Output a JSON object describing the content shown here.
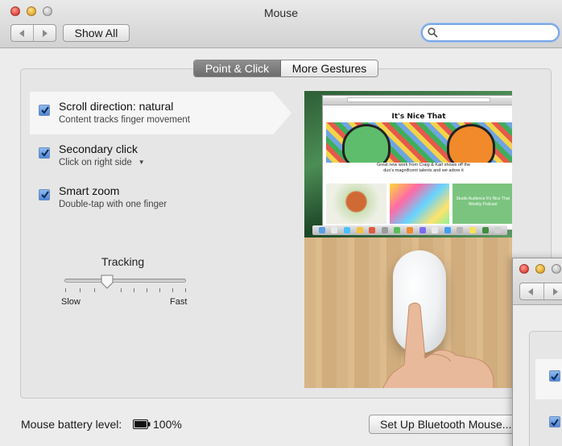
{
  "window": {
    "title": "Mouse",
    "show_all_label": "Show All",
    "search_placeholder": ""
  },
  "tabs": [
    {
      "label": "Point & Click",
      "selected": true
    },
    {
      "label": "More Gestures",
      "selected": false
    }
  ],
  "options": [
    {
      "title": "Scroll direction: natural",
      "subtitle": "Content tracks finger movement",
      "checked": true,
      "highlighted": true
    },
    {
      "title": "Secondary click",
      "subtitle": "Click on right side",
      "checked": true,
      "has_dropdown": true
    },
    {
      "title": "Smart zoom",
      "subtitle": "Double-tap with one finger",
      "checked": true
    }
  ],
  "tracking": {
    "label": "Tracking",
    "min_label": "Slow",
    "max_label": "Fast",
    "value_fraction": 0.35
  },
  "preview": {
    "site_title": "It's Nice That",
    "caption": "Great new work from Craig & Karl shows off the duo's magnificent talents and we adore it",
    "tile_text": "Studio Audience It's Nice That Weekly Podcast"
  },
  "footer": {
    "battery_label": "Mouse battery level:",
    "battery_value": "100%",
    "bluetooth_button": "Set Up Bluetooth Mouse..."
  },
  "colors": {
    "accent_checkbox": "#4f86d6",
    "search_focus": "#7aa7e6",
    "selected_tab": "#7a7a7a"
  },
  "icons": {
    "back": "chevron-left-icon",
    "forward": "chevron-right-icon",
    "search": "magnifier-icon",
    "battery": "battery-full-icon",
    "dropdown": "triangle-down-icon"
  }
}
